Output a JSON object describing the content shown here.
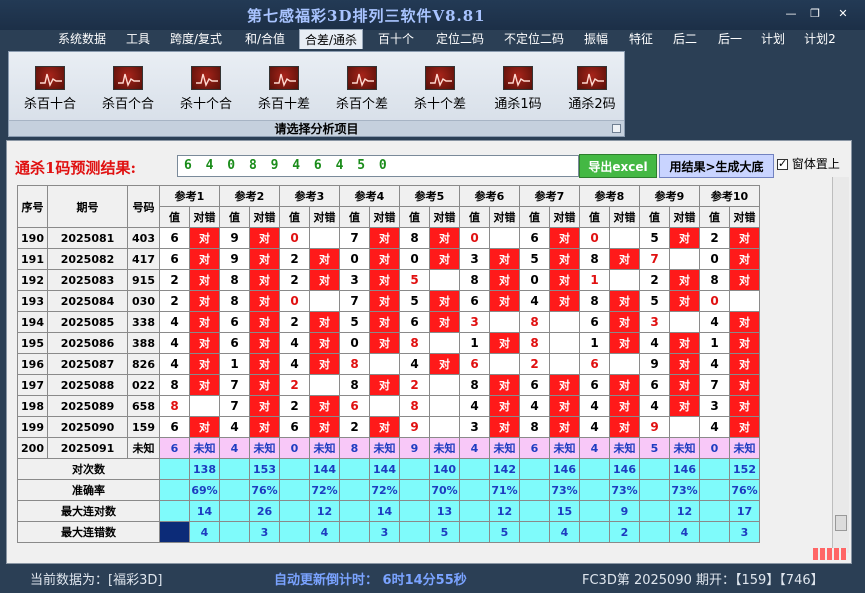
{
  "title": "第七感福彩3D排列三软件V8.81",
  "window_controls": [
    "—",
    "❐",
    "✕"
  ],
  "menu": [
    "系统数据",
    "工具",
    "跨度/复式",
    "和/合值",
    "合差/通杀",
    "百十个",
    "定位二码",
    "不定位二码",
    "振幅",
    "特征",
    "后二",
    "后一",
    "计划",
    "计划2"
  ],
  "menu_active": "合差/通杀",
  "ribbon": {
    "buttons": [
      "杀百十合",
      "杀百个合",
      "杀十个合",
      "杀百十差",
      "杀百个差",
      "杀十个差",
      "通杀1码",
      "通杀2码"
    ],
    "caption": "请选择分析项目"
  },
  "prediction": {
    "label": "通杀1码预测结果:",
    "result": "6 4 0 8 9 4 6 4 5 0",
    "export_label": "导出excel",
    "generate_label": "用结果>生成大底",
    "ontop_label": "窗体置上",
    "ontop_checked": true
  },
  "table": {
    "headers": [
      "序号",
      "期号",
      "号码"
    ],
    "ref_headers": [
      "参考1",
      "参考2",
      "参考3",
      "参考4",
      "参考5",
      "参考6",
      "参考7",
      "参考8",
      "参考9",
      "参考10"
    ],
    "sub_value": "值",
    "sub_result": "对错",
    "hit_text": "对",
    "rows": [
      {
        "seq": "190",
        "period": "2025081",
        "num": "403",
        "refs": [
          [
            "6",
            1
          ],
          [
            "9",
            1
          ],
          [
            "0",
            0
          ],
          [
            "7",
            1
          ],
          [
            "8",
            1
          ],
          [
            "0",
            0
          ],
          [
            "6",
            1
          ],
          [
            "0",
            0
          ],
          [
            "5",
            1
          ],
          [
            "2",
            1
          ]
        ]
      },
      {
        "seq": "191",
        "period": "2025082",
        "num": "417",
        "refs": [
          [
            "6",
            1
          ],
          [
            "9",
            1
          ],
          [
            "2",
            1
          ],
          [
            "0",
            1
          ],
          [
            "0",
            1
          ],
          [
            "3",
            1
          ],
          [
            "5",
            1
          ],
          [
            "8",
            1
          ],
          [
            "7",
            0
          ],
          [
            "0",
            1
          ]
        ]
      },
      {
        "seq": "192",
        "period": "2025083",
        "num": "915",
        "refs": [
          [
            "2",
            1
          ],
          [
            "8",
            1
          ],
          [
            "2",
            1
          ],
          [
            "3",
            1
          ],
          [
            "5",
            0
          ],
          [
            "8",
            1
          ],
          [
            "0",
            1
          ],
          [
            "1",
            0
          ],
          [
            "2",
            1
          ],
          [
            "8",
            1
          ]
        ]
      },
      {
        "seq": "193",
        "period": "2025084",
        "num": "030",
        "refs": [
          [
            "2",
            1
          ],
          [
            "8",
            1
          ],
          [
            "0",
            0
          ],
          [
            "7",
            1
          ],
          [
            "5",
            1
          ],
          [
            "6",
            1
          ],
          [
            "4",
            1
          ],
          [
            "8",
            1
          ],
          [
            "5",
            1
          ],
          [
            "0",
            0
          ]
        ]
      },
      {
        "seq": "194",
        "period": "2025085",
        "num": "338",
        "refs": [
          [
            "4",
            1
          ],
          [
            "6",
            1
          ],
          [
            "2",
            1
          ],
          [
            "5",
            1
          ],
          [
            "6",
            1
          ],
          [
            "3",
            0
          ],
          [
            "8",
            0
          ],
          [
            "6",
            1
          ],
          [
            "3",
            0
          ],
          [
            "4",
            1
          ]
        ]
      },
      {
        "seq": "195",
        "period": "2025086",
        "num": "388",
        "refs": [
          [
            "4",
            1
          ],
          [
            "6",
            1
          ],
          [
            "4",
            1
          ],
          [
            "0",
            1
          ],
          [
            "8",
            0
          ],
          [
            "1",
            1
          ],
          [
            "8",
            0
          ],
          [
            "1",
            1
          ],
          [
            "4",
            1
          ],
          [
            "1",
            1
          ]
        ]
      },
      {
        "seq": "196",
        "period": "2025087",
        "num": "826",
        "refs": [
          [
            "4",
            1
          ],
          [
            "1",
            1
          ],
          [
            "4",
            1
          ],
          [
            "8",
            0
          ],
          [
            "4",
            1
          ],
          [
            "6",
            0
          ],
          [
            "2",
            0
          ],
          [
            "6",
            0
          ],
          [
            "9",
            1
          ],
          [
            "4",
            1
          ]
        ]
      },
      {
        "seq": "197",
        "period": "2025088",
        "num": "022",
        "refs": [
          [
            "8",
            1
          ],
          [
            "7",
            1
          ],
          [
            "2",
            0
          ],
          [
            "8",
            1
          ],
          [
            "2",
            0
          ],
          [
            "8",
            1
          ],
          [
            "6",
            1
          ],
          [
            "6",
            1
          ],
          [
            "6",
            1
          ],
          [
            "7",
            1
          ]
        ]
      },
      {
        "seq": "198",
        "period": "2025089",
        "num": "658",
        "refs": [
          [
            "8",
            0
          ],
          [
            "7",
            1
          ],
          [
            "2",
            1
          ],
          [
            "6",
            0
          ],
          [
            "8",
            0
          ],
          [
            "4",
            1
          ],
          [
            "4",
            1
          ],
          [
            "4",
            1
          ],
          [
            "4",
            1
          ],
          [
            "3",
            1
          ]
        ]
      },
      {
        "seq": "199",
        "period": "2025090",
        "num": "159",
        "refs": [
          [
            "6",
            1
          ],
          [
            "4",
            1
          ],
          [
            "6",
            1
          ],
          [
            "2",
            1
          ],
          [
            "9",
            0
          ],
          [
            "3",
            1
          ],
          [
            "8",
            1
          ],
          [
            "4",
            1
          ],
          [
            "9",
            0
          ],
          [
            "4",
            1
          ]
        ]
      }
    ],
    "forecast": {
      "seq": "200",
      "period": "2025091",
      "num": "未知",
      "values": [
        "6",
        "4",
        "0",
        "8",
        "9",
        "4",
        "6",
        "4",
        "5",
        "0"
      ],
      "unknown": "未知"
    },
    "stats": [
      {
        "label": "对次数",
        "values": [
          "138",
          "153",
          "144",
          "144",
          "140",
          "142",
          "146",
          "146",
          "146",
          "152"
        ]
      },
      {
        "label": "准确率",
        "values": [
          "69%",
          "76%",
          "72%",
          "72%",
          "70%",
          "71%",
          "73%",
          "73%",
          "73%",
          "76%"
        ]
      },
      {
        "label": "最大连对数",
        "values": [
          "14",
          "26",
          "12",
          "14",
          "13",
          "12",
          "15",
          "9",
          "12",
          "17"
        ]
      },
      {
        "label": "最大连错数",
        "values": [
          "4",
          "3",
          "4",
          "3",
          "5",
          "5",
          "4",
          "2",
          "4",
          "3"
        ]
      }
    ]
  },
  "status": {
    "current_data": "当前数据为：[福彩3D]",
    "countdown": "自动更新倒计时： 6时14分55秒",
    "draw_info": "FC3D第 2025090 期开：【159】【746】"
  }
}
